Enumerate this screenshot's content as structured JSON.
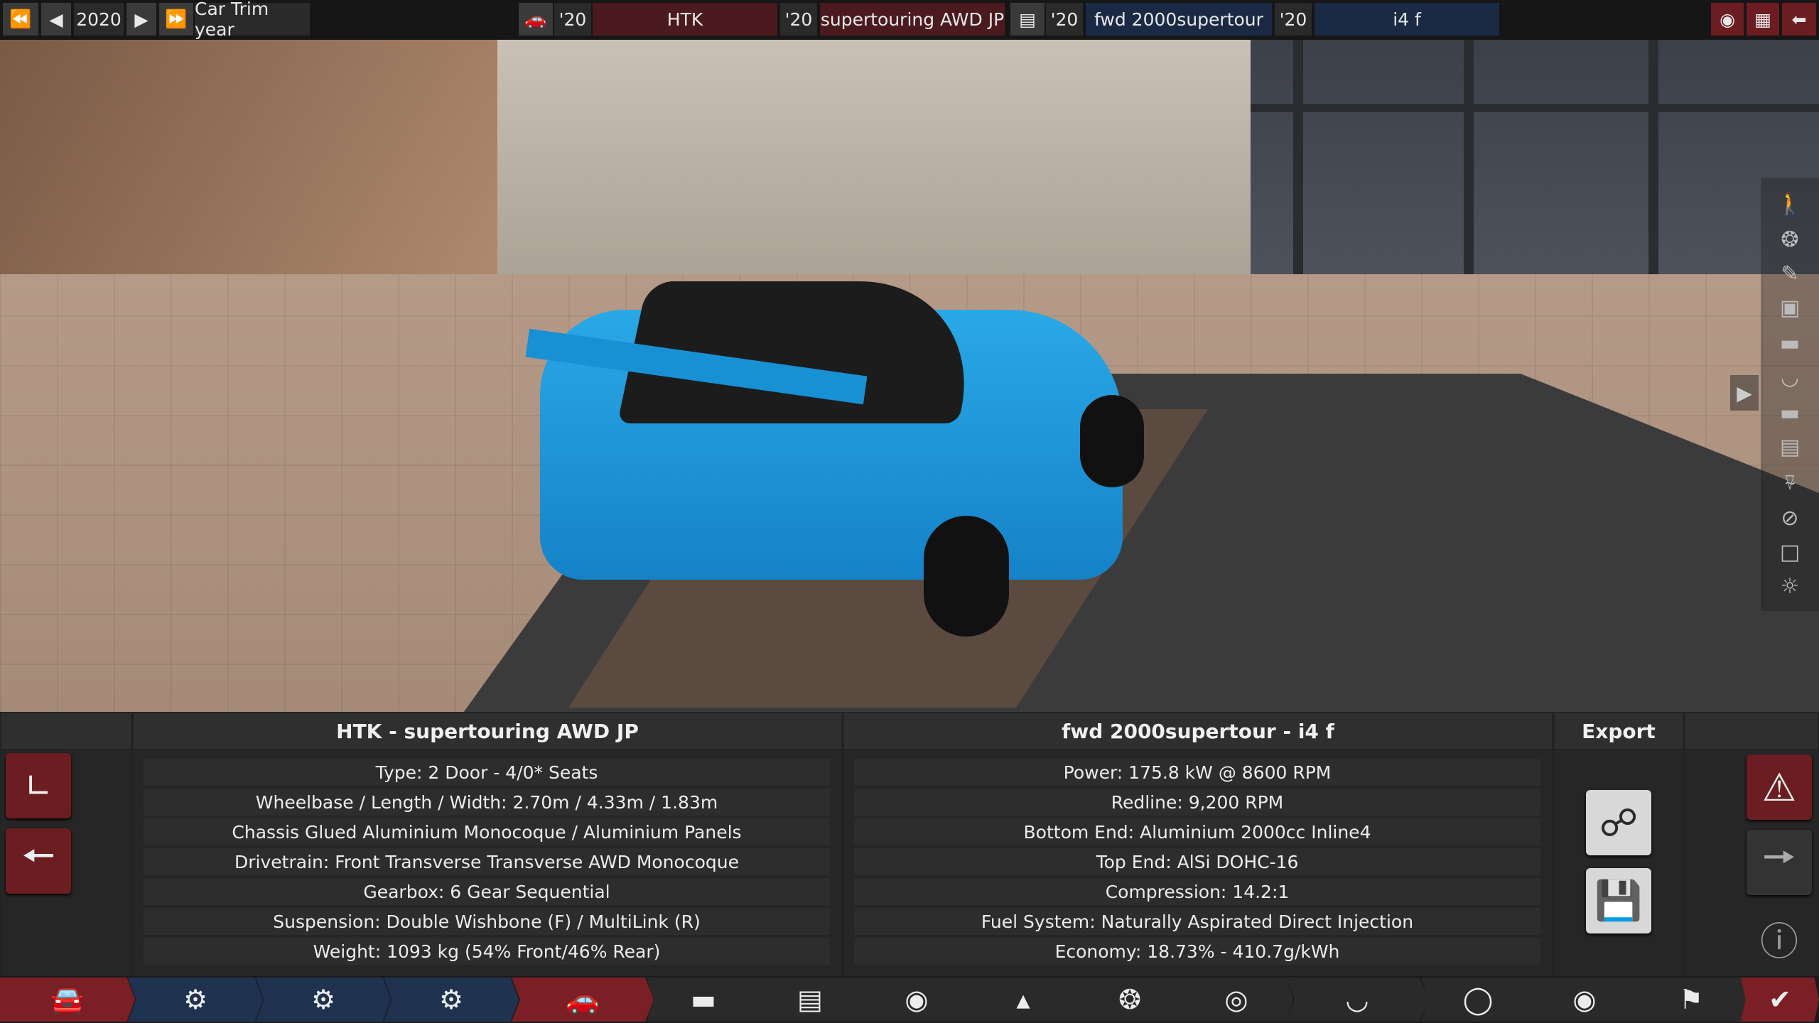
{
  "topbar": {
    "year": "2020",
    "year_label": "Car Trim year",
    "model_year": "'20",
    "model": "HTK",
    "trim_year": "'20",
    "trim": "supertouring AWD JP",
    "engine_family_year": "'20",
    "engine_family": "fwd 2000supertour",
    "engine_variant_year": "'20",
    "engine_variant": "i4 f"
  },
  "car_panel": {
    "title": "HTK - supertouring AWD JP",
    "rows": [
      "Type: 2 Door - 4/0* Seats",
      "Wheelbase / Length / Width: 2.70m / 4.33m / 1.83m",
      "Chassis Glued Aluminium Monocoque / Aluminium Panels",
      "Drivetrain: Front Transverse Transverse AWD Monocoque",
      "Gearbox: 6 Gear Sequential",
      "Suspension: Double Wishbone (F) / MultiLink (R)",
      "Weight: 1093 kg (54% Front/46% Rear)"
    ]
  },
  "engine_panel": {
    "title": "fwd 2000supertour - i4 f",
    "rows": [
      "Power: 175.8 kW @ 8600 RPM",
      "Redline:  9,200 RPM",
      "Bottom End: Aluminium 2000cc Inline4",
      "Top End: AlSi DOHC-16",
      "Compression: 14.2:1",
      "Fuel System: Naturally Aspirated Direct Injection",
      "Economy: 18.73% - 410.7g/kWh"
    ]
  },
  "export_panel": {
    "title": "Export"
  },
  "icons": {
    "rewind": "double-left-arrow-icon",
    "prev": "left-arrow-icon",
    "next": "right-arrow-icon",
    "forward": "double-right-arrow-icon",
    "camera": "camera-icon",
    "layout": "layout-icon",
    "back": "back-arrow-icon"
  },
  "colors": {
    "accent_red": "#7a1f25",
    "accent_blue": "#1f3350",
    "car_blue": "#1e9ad9"
  }
}
